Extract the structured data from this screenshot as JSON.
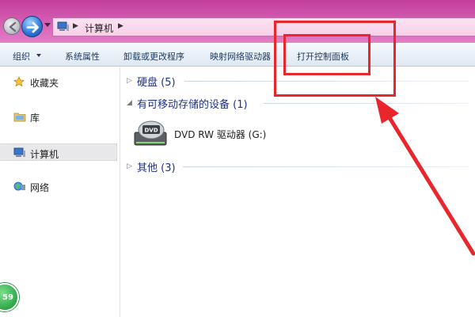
{
  "address_bar": {
    "location": "计算机"
  },
  "toolbar": {
    "organize": "组织",
    "system_properties": "系统属性",
    "uninstall": "卸载或更改程序",
    "map_drive": "映射网络驱动器",
    "open_control_panel": "打开控制面板"
  },
  "sidebar": {
    "favorites": "收藏夹",
    "libraries": "库",
    "computer": "计算机",
    "network": "网络"
  },
  "content": {
    "groups": [
      {
        "label": "硬盘 (5)",
        "expanded": false
      },
      {
        "label": "有可移动存储的设备 (1)",
        "expanded": true
      },
      {
        "label": "其他 (3)",
        "expanded": false
      }
    ],
    "drive": {
      "label": "DVD RW 驱动器 (G:)",
      "icon_text": "DVD"
    }
  },
  "badge": {
    "value": "59"
  },
  "colors": {
    "annotation": "#e8262c",
    "titlebar": "#d25ab0",
    "group_header_text": "#1e3287"
  },
  "icons": {
    "back": "arrow-left-icon",
    "forward": "arrow-right-icon",
    "computer": "computer-icon",
    "favorites": "star-icon",
    "libraries": "folder-icon",
    "network": "network-globe-icon",
    "drive": "dvd-drive-icon"
  }
}
